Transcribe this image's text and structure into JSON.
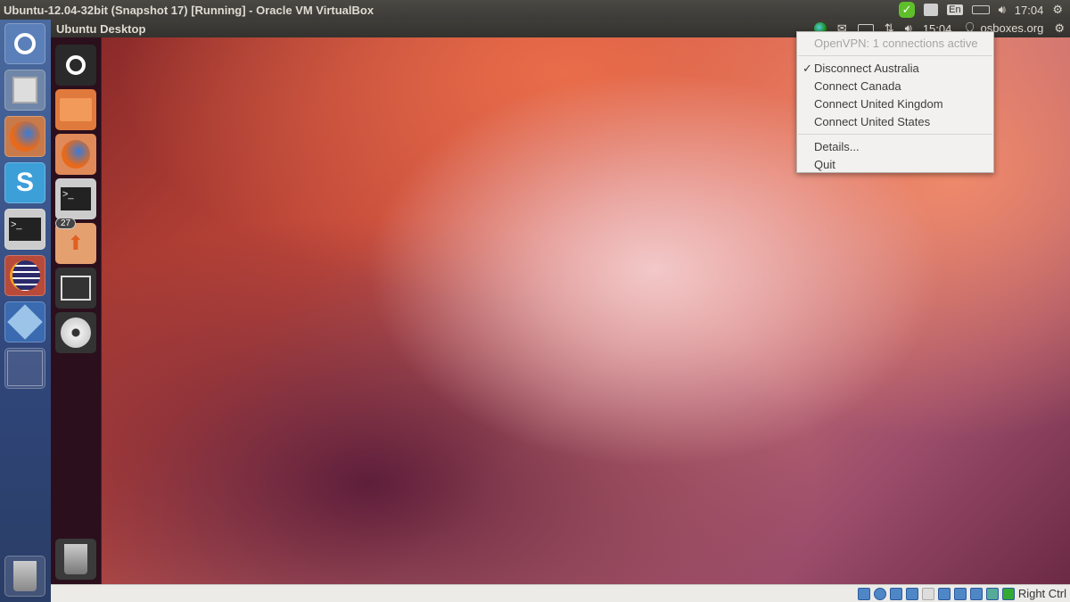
{
  "host": {
    "window_title": "Ubuntu-12.04-32bit (Snapshot 17) [Running] - Oracle VM VirtualBox",
    "keyboard_layout": "En",
    "clock": "17:04"
  },
  "host_launcher": {
    "items": [
      {
        "name": "dash-home",
        "label": "Dash Home"
      },
      {
        "name": "file-manager",
        "label": "Files"
      },
      {
        "name": "firefox",
        "label": "Firefox"
      },
      {
        "name": "skype",
        "label": "Skype"
      },
      {
        "name": "terminal",
        "label": "Terminal"
      },
      {
        "name": "eclipse",
        "label": "Eclipse"
      },
      {
        "name": "virtualbox",
        "label": "VirtualBox"
      },
      {
        "name": "workspace-switcher",
        "label": "Workspace Switcher"
      },
      {
        "name": "trash",
        "label": "Trash"
      }
    ]
  },
  "guest": {
    "panel_title": "Ubuntu Desktop",
    "clock": "15:04",
    "user": "osboxes.org",
    "launcher": {
      "items": [
        {
          "name": "dash-home",
          "label": "Dash Home"
        },
        {
          "name": "home-folder",
          "label": "Home Folder"
        },
        {
          "name": "firefox",
          "label": "Firefox"
        },
        {
          "name": "terminal",
          "label": "Terminal"
        },
        {
          "name": "update-manager",
          "label": "Update Manager",
          "badge": "27"
        },
        {
          "name": "workspace-switcher",
          "label": "Workspace Switcher"
        },
        {
          "name": "disc",
          "label": "CD/DVD"
        },
        {
          "name": "trash",
          "label": "Trash"
        }
      ]
    },
    "vpn_menu": {
      "header": "OpenVPN: 1 connections active",
      "items": [
        {
          "label": "Disconnect Australia",
          "checked": true
        },
        {
          "label": "Connect Canada",
          "checked": false
        },
        {
          "label": "Connect United Kingdom",
          "checked": false
        },
        {
          "label": "Connect United States",
          "checked": false
        }
      ],
      "details": "Details...",
      "quit": "Quit"
    }
  },
  "statusbar": {
    "host_key": "Right Ctrl"
  },
  "colors": {
    "accent_green": "#4caf2a",
    "panel_bg": "#3c3b37"
  }
}
